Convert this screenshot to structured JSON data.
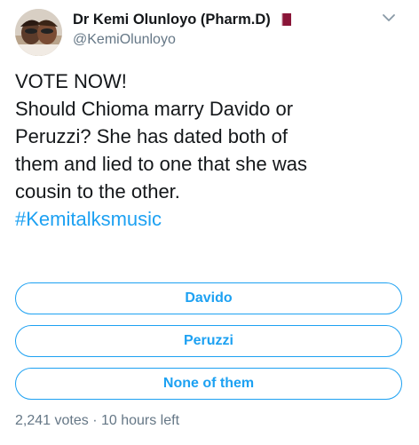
{
  "author": {
    "display_name": "Dr Kemi Olunloyo (Pharm.D)",
    "handle": "@KemiOlunloyo",
    "flag_icon": "qatar-flag-icon",
    "avatar_icon": "avatar-photo"
  },
  "tweet": {
    "lines": [
      "VOTE NOW!",
      "Should Chioma marry Davido or",
      "Peruzzi? She has dated both of",
      "them and lied to one that she was",
      "cousin to the other."
    ],
    "hashtag": "#Kemitalksmusic"
  },
  "poll": {
    "options": [
      "Davido",
      "Peruzzi",
      "None of them"
    ],
    "votes": "2,241 votes",
    "separator": "·",
    "time_left": "10 hours left"
  },
  "colors": {
    "accent": "#1da1f2",
    "secondary_text": "#657786",
    "primary_text": "#14171a",
    "flag_maroon": "#8a1538"
  },
  "menu": {
    "caret_icon": "chevron-down-icon"
  }
}
